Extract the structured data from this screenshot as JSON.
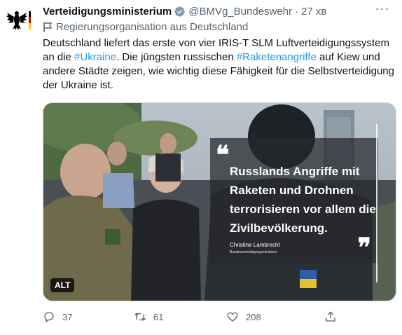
{
  "tweet": {
    "author_name": "Verteidigungsministerium",
    "handle": "@BMVg_Bundeswehr",
    "separator": "·",
    "time": "27 хв",
    "more": "···",
    "affiliation": "Regierungsorganisation aus Deutschland",
    "text": {
      "part1": "Deutschland liefert das erste von vier IRIS-T SLM Luftverteidigungssystem an die ",
      "hashtag1": "#Ukraine",
      "part2": ". Die jüngsten russischen ",
      "hashtag2": "#Raketenangriffe",
      "part3": " auf Kiew und andere Städte zeigen, wie wichtig diese Fähigkeit für die Selbstverteidigung der Ukraine ist."
    }
  },
  "media": {
    "quote_open": "❝",
    "quote_text": "Russlands Angriffe mit Raketen und Drohnen terrorisieren vor allem die Zivilbevölkerung.",
    "quote_author": "Christine Lambrecht",
    "quote_role": "Bundesverteidigungsministerin",
    "quote_close": "❞",
    "alt_badge": "ALT"
  },
  "actions": {
    "replies": "37",
    "retweets": "61",
    "likes": "208"
  },
  "icons": {
    "avatar": "federal-eagle-icon",
    "verified": "verified-badge-icon",
    "affiliation": "flag-icon",
    "reply": "reply-icon",
    "retweet": "retweet-icon",
    "like": "heart-icon",
    "share": "share-icon"
  },
  "colors": {
    "accent": "#1d9bf0",
    "secondary_text": "#536471",
    "primary_text": "#0f1419"
  }
}
